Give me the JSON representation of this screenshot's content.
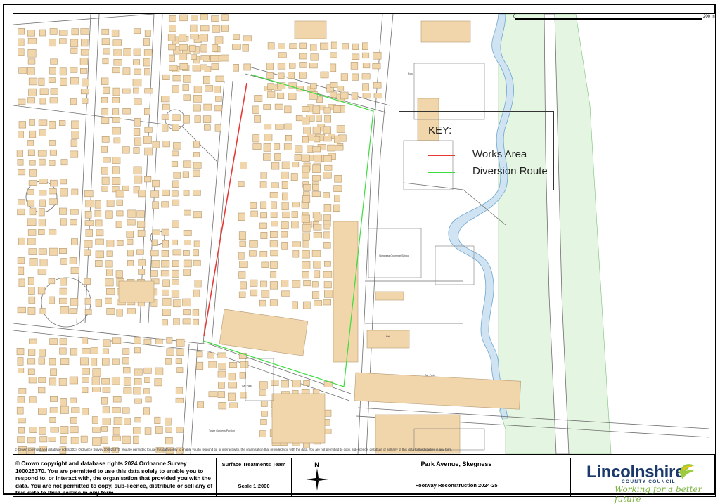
{
  "map": {
    "scale_zero": "0",
    "scale_end": "200 m",
    "copyright_strip": "© Crown copyright and database rights 2024 Ordnance Survey 100025370. You are permitted to use this data solely to enable you to respond to, or interact with, the organisation that provided you with the data. You are not permitted to copy, sub-licence, distribute or sell any of this data to third parties in any form.",
    "labels": {
      "car_park_1": "Car Park",
      "car_park_2": "Car Park",
      "school": "Skegness Grammar School",
      "pond": "Pond",
      "hall": "Hall",
      "tower": "Tower Gardens Pavilion"
    }
  },
  "key": {
    "title": "KEY:",
    "items": [
      {
        "label": "Works Area",
        "color": "#e53935"
      },
      {
        "label": "Diversion Route",
        "color": "#3ddc3d"
      }
    ]
  },
  "footer": {
    "copyright": "© Crown copyright and database rights 2024 Ordnance Survey 100025370. You are permitted to use this data solely to enable you to respond to, or interact with, the organisation that provided you with the data. You are not permitted to copy, sub-licence, distribute or sell any of this data to third parties in any form.",
    "team": "Surface Treatments Team",
    "scale": "Scale 1:2000",
    "north": "N",
    "location": "Park Avenue, Skegness",
    "project": "Footway Reconstruction 2024-25",
    "logo_name": "Lincolnshire",
    "logo_council": "COUNTY COUNCIL",
    "logo_tagline": "Working for a better future"
  },
  "colors": {
    "building": "#f2d6ab",
    "building_stroke": "#b49a74",
    "road": "#6e6e6e",
    "river": "#cfe3f3",
    "river_stroke": "#6fa6cf",
    "grass": "#e4f5e1",
    "works": "#e53935",
    "diversion": "#3ddc3d"
  }
}
